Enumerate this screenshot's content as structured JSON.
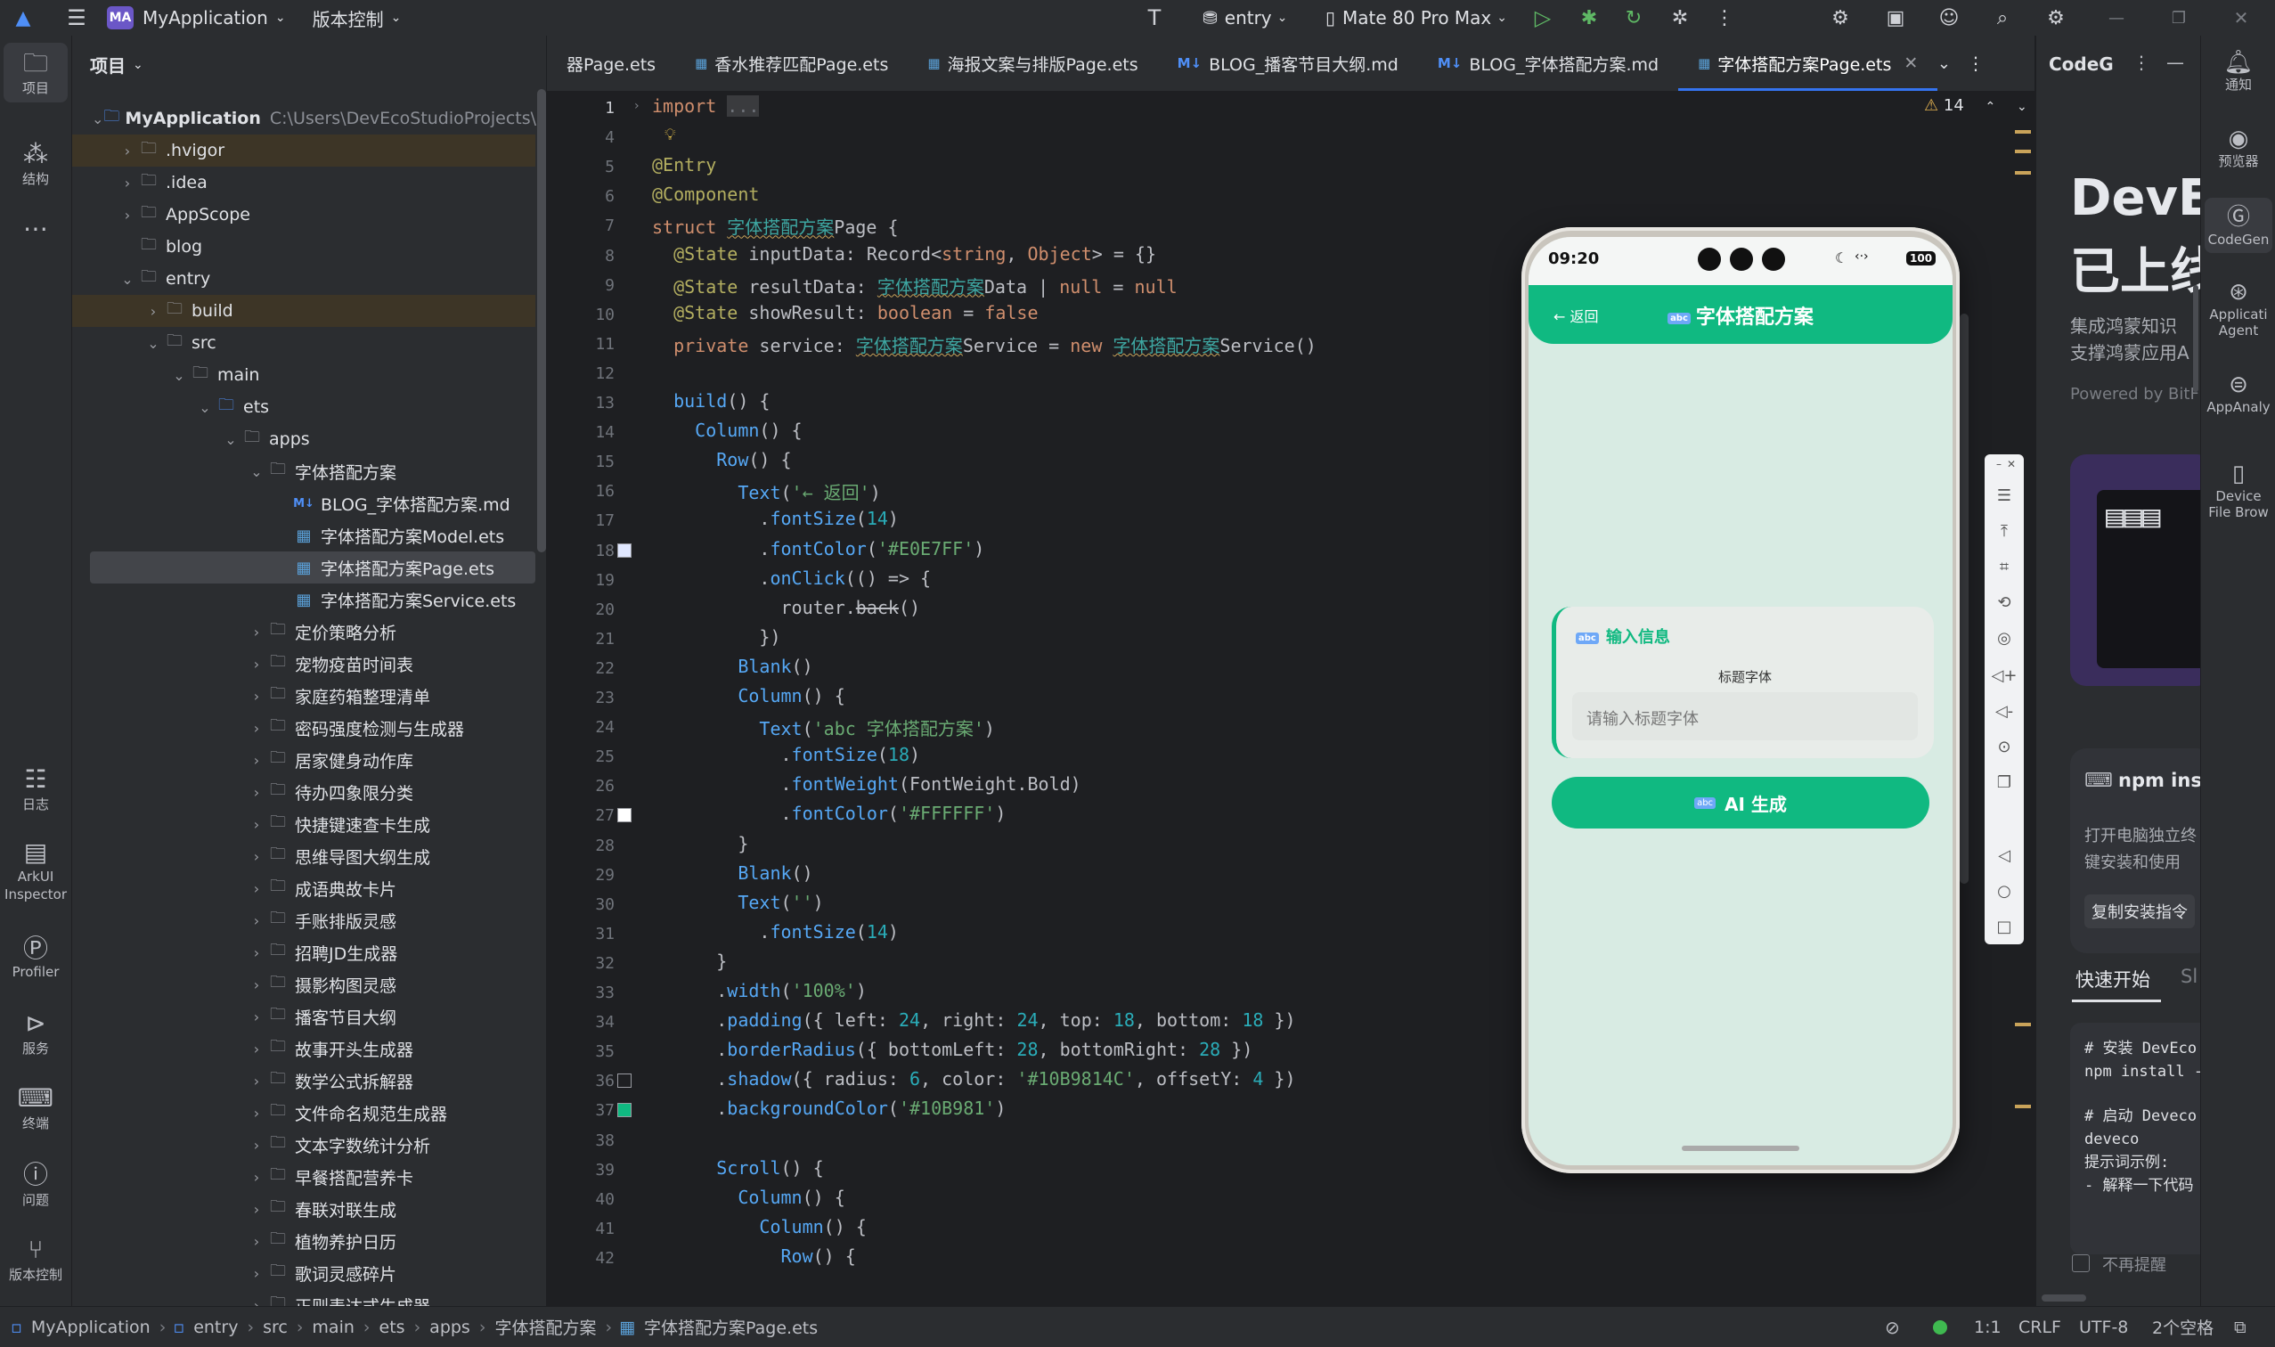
{
  "topbar": {
    "app_badge": "MA",
    "app_name": "MyApplication",
    "version_control": "版本控制",
    "run_config": "entry",
    "device": "Mate 80 Pro Max"
  },
  "left_tools": [
    {
      "label": "项目",
      "icon": "folder-icon"
    },
    {
      "label": "结构",
      "icon": "structure-icon"
    },
    {
      "label": "日志",
      "icon": "log-icon"
    },
    {
      "label": "ArkUI Inspector",
      "icon": "inspector-icon"
    },
    {
      "label": "Profiler",
      "icon": "profiler-icon"
    },
    {
      "label": "服务",
      "icon": "services-icon"
    },
    {
      "label": "终端",
      "icon": "terminal-icon"
    },
    {
      "label": "问题",
      "icon": "problems-icon"
    },
    {
      "label": "版本控制",
      "icon": "vcs-icon"
    }
  ],
  "project": {
    "title": "项目",
    "root_path": "C:\\Users\\DevEcoStudioProjects\\My",
    "tree": [
      {
        "label": "MyApplication",
        "depth": 0,
        "open": true,
        "icon": "folder"
      },
      {
        "label": ".hvigor",
        "depth": 1,
        "open": false,
        "icon": "folder"
      },
      {
        "label": ".idea",
        "depth": 1,
        "open": false,
        "icon": "folder"
      },
      {
        "label": "AppScope",
        "depth": 1,
        "open": false,
        "icon": "folder"
      },
      {
        "label": "blog",
        "depth": 1,
        "open": null,
        "icon": "folder"
      },
      {
        "label": "entry",
        "depth": 1,
        "open": true,
        "icon": "folder"
      },
      {
        "label": "build",
        "depth": 2,
        "open": false,
        "icon": "folder"
      },
      {
        "label": "src",
        "depth": 2,
        "open": true,
        "icon": "folder"
      },
      {
        "label": "main",
        "depth": 3,
        "open": true,
        "icon": "folder"
      },
      {
        "label": "ets",
        "depth": 4,
        "open": true,
        "icon": "folder"
      },
      {
        "label": "apps",
        "depth": 5,
        "open": true,
        "icon": "folder"
      },
      {
        "label": "字体搭配方案",
        "depth": 6,
        "open": true,
        "icon": "folder"
      },
      {
        "label": "BLOG_字体搭配方案.md",
        "depth": 7,
        "open": null,
        "icon": "md"
      },
      {
        "label": "字体搭配方案Model.ets",
        "depth": 7,
        "open": null,
        "icon": "ets"
      },
      {
        "label": "字体搭配方案Page.ets",
        "depth": 7,
        "open": null,
        "icon": "ets"
      },
      {
        "label": "字体搭配方案Service.ets",
        "depth": 7,
        "open": null,
        "icon": "ets"
      },
      {
        "label": "定价策略分析",
        "depth": 6,
        "open": false,
        "icon": "folder"
      },
      {
        "label": "宠物疫苗时间表",
        "depth": 6,
        "open": false,
        "icon": "folder"
      },
      {
        "label": "家庭药箱整理清单",
        "depth": 6,
        "open": false,
        "icon": "folder"
      },
      {
        "label": "密码强度检测与生成器",
        "depth": 6,
        "open": false,
        "icon": "folder"
      },
      {
        "label": "居家健身动作库",
        "depth": 6,
        "open": false,
        "icon": "folder"
      },
      {
        "label": "待办四象限分类",
        "depth": 6,
        "open": false,
        "icon": "folder"
      },
      {
        "label": "快捷键速查卡生成",
        "depth": 6,
        "open": false,
        "icon": "folder"
      },
      {
        "label": "思维导图大纲生成",
        "depth": 6,
        "open": false,
        "icon": "folder"
      },
      {
        "label": "成语典故卡片",
        "depth": 6,
        "open": false,
        "icon": "folder"
      },
      {
        "label": "手账排版灵感",
        "depth": 6,
        "open": false,
        "icon": "folder"
      },
      {
        "label": "招聘JD生成器",
        "depth": 6,
        "open": false,
        "icon": "folder"
      },
      {
        "label": "摄影构图灵感",
        "depth": 6,
        "open": false,
        "icon": "folder"
      },
      {
        "label": "播客节目大纲",
        "depth": 6,
        "open": false,
        "icon": "folder"
      },
      {
        "label": "故事开头生成器",
        "depth": 6,
        "open": false,
        "icon": "folder"
      },
      {
        "label": "数学公式拆解器",
        "depth": 6,
        "open": false,
        "icon": "folder"
      },
      {
        "label": "文件命名规范生成器",
        "depth": 6,
        "open": false,
        "icon": "folder"
      },
      {
        "label": "文本字数统计分析",
        "depth": 6,
        "open": false,
        "icon": "folder"
      },
      {
        "label": "早餐搭配营养卡",
        "depth": 6,
        "open": false,
        "icon": "folder"
      },
      {
        "label": "春联对联生成",
        "depth": 6,
        "open": false,
        "icon": "folder"
      },
      {
        "label": "植物养护日历",
        "depth": 6,
        "open": false,
        "icon": "folder"
      },
      {
        "label": "歌词灵感碎片",
        "depth": 6,
        "open": false,
        "icon": "folder"
      },
      {
        "label": "正则表达式生成器",
        "depth": 6,
        "open": false,
        "icon": "folder"
      }
    ]
  },
  "tabs": [
    {
      "label": "器Page.ets",
      "icon": "",
      "active": false
    },
    {
      "label": "香水推荐匹配Page.ets",
      "icon": "ets",
      "active": false
    },
    {
      "label": "海报文案与排版Page.ets",
      "icon": "ets",
      "active": false
    },
    {
      "label": "BLOG_播客节目大纲.md",
      "icon": "M↓",
      "active": false
    },
    {
      "label": "BLOG_字体搭配方案.md",
      "icon": "M↓",
      "active": false
    },
    {
      "label": "字体搭配方案Page.ets",
      "icon": "ets",
      "active": true
    }
  ],
  "editor": {
    "warnings_count": "14",
    "line_numbers": [
      "1",
      "4",
      "5",
      "6",
      "7",
      "8",
      "9",
      "10",
      "11",
      "12",
      "13",
      "14",
      "15",
      "16",
      "17",
      "18",
      "19",
      "20",
      "21",
      "22",
      "23",
      "24",
      "25",
      "26",
      "27",
      "28",
      "29",
      "30",
      "31",
      "32",
      "33",
      "34",
      "35",
      "36",
      "37",
      "38",
      "39",
      "40",
      "41",
      "42"
    ]
  },
  "preview": {
    "time": "09:20",
    "battery": "100",
    "back_label": "← 返回",
    "app_title": "字体搭配方案",
    "card_title": "输入信息",
    "field_label": "标题字体",
    "field_placeholder": "请输入标题字体",
    "ai_button": "AI 生成"
  },
  "right_panel": {
    "header": "CodeG",
    "hero_line1": "DevE",
    "hero_line2": "已上线",
    "desc1": "集成鸿蒙知识",
    "desc2": "支撑鸿蒙应用A",
    "powered": "Powered by BitF",
    "npm_title": "npm ins",
    "npm_desc1": "打开电脑独立终",
    "npm_desc2": "键安装和使用",
    "copy_btn": "复制安装指令",
    "quick_tab": "快速开始",
    "quick_tab2": "Sl",
    "code1": "# 安装 DevEco",
    "code2": "npm install -",
    "code3": "# 启动 Deveco",
    "code4": "deveco",
    "code5": "提示词示例:",
    "code6": "- 解释一下代码",
    "no_remind": "不再提醒"
  },
  "right_tools": [
    {
      "label": "通知",
      "icon": "bell-icon"
    },
    {
      "label": "预览器",
      "icon": "eye-icon"
    },
    {
      "label": "CodeGen",
      "icon": "codegen-icon"
    },
    {
      "label": "Applicati Agent",
      "icon": "agent-icon"
    },
    {
      "label": "AppAnaly",
      "icon": "analyzer-icon"
    },
    {
      "label": "Device File Brow",
      "icon": "device-icon"
    }
  ],
  "statusbar": {
    "crumbs": [
      "MyApplication",
      "entry",
      "src",
      "main",
      "ets",
      "apps",
      "字体搭配方案",
      "字体搭配方案Page.ets"
    ],
    "position": "1:1",
    "line_sep": "CRLF",
    "encoding": "UTF-8",
    "indent": "2个空格"
  },
  "colors": {
    "accent": "#10B981",
    "selection": "#3574F0"
  }
}
